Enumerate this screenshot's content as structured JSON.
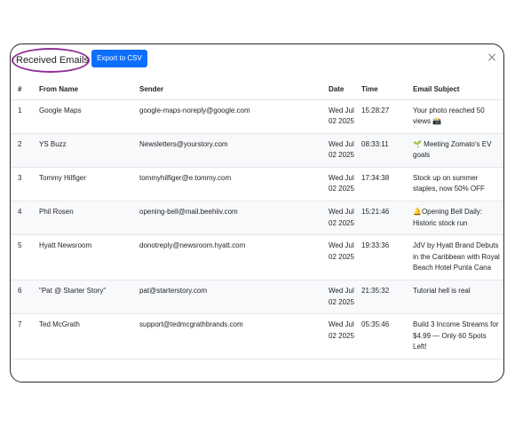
{
  "modal": {
    "title": "Received Emails |",
    "export_label": "Export to CSV",
    "close_glyph": "×"
  },
  "table": {
    "headers": [
      "#",
      "From Name",
      "Sender",
      "Date",
      "Time",
      "Email Subject"
    ],
    "rows": [
      {
        "num": "1",
        "from": "Google Maps",
        "sender": "google-maps-noreply@google.com",
        "date": "Wed Jul 02 2025",
        "time": "15:28:27",
        "subject": "Your photo reached 50 views 📸"
      },
      {
        "num": "2",
        "from": "YS Buzz",
        "sender": "Newsletters@yourstory.com",
        "date": "Wed Jul 02 2025",
        "time": "08:33:11",
        "subject": "🌱 Meeting Zomato's EV goals"
      },
      {
        "num": "3",
        "from": "Tommy Hilfiger",
        "sender": "tommyhilfiger@e.tommy.com",
        "date": "Wed Jul 02 2025",
        "time": "17:34:38",
        "subject": "Stock up on summer staples, now 50% OFF"
      },
      {
        "num": "4",
        "from": "Phil Rosen",
        "sender": "opening-bell@mail.beehiiv.com",
        "date": "Wed Jul 02 2025",
        "time": "15:21:46",
        "subject": "🔔Opening Bell Daily: Historic stock run"
      },
      {
        "num": "5",
        "from": "Hyatt Newsroom",
        "sender": "donotreply@newsroom.hyatt.com",
        "date": "Wed Jul 02 2025",
        "time": "19:33:36",
        "subject": "JdV by Hyatt Brand Debuts in the Caribbean with Royal Beach Hotel Punta Cana"
      },
      {
        "num": "6",
        "from": "\"Pat @ Starter Story\"",
        "sender": "pat@starterstory.com",
        "date": "Wed Jul 02 2025",
        "time": "21:35:32",
        "subject": "Tutorial hell is real"
      },
      {
        "num": "7",
        "from": "Ted McGrath",
        "sender": "support@tedmcgrathbrands.com",
        "date": "Wed Jul 02 2025",
        "time": "05:35:46",
        "subject": "Build 3 Income Streams for $4.99 — Only 60 Spots Left!"
      }
    ]
  },
  "colors": {
    "accent": "#0d6efd",
    "highlight_ellipse": "#8e2f96",
    "stripe": "#f8f9fa"
  }
}
